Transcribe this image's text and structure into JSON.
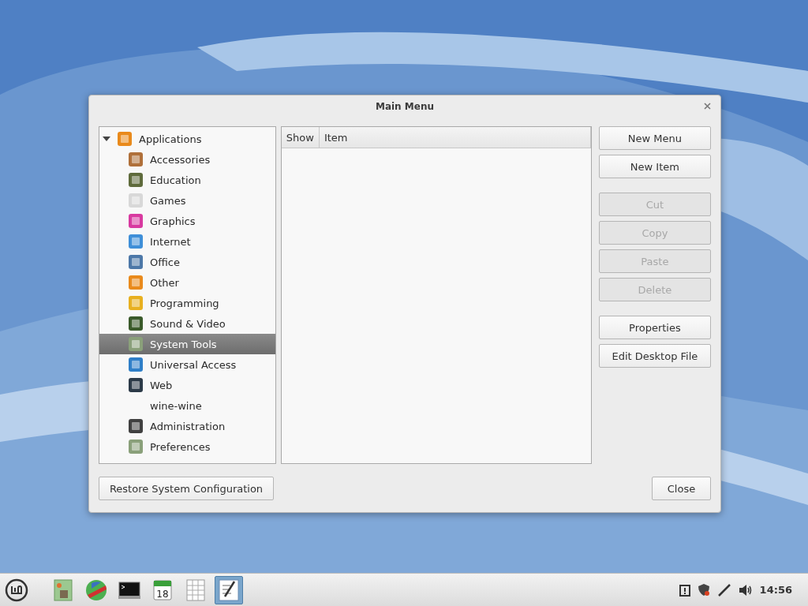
{
  "window": {
    "title": "Main Menu"
  },
  "tree": {
    "label": "Applications",
    "kind": "folder",
    "expanded": true,
    "children": [
      {
        "label": "Accessories",
        "kind": "accessories",
        "selected": false
      },
      {
        "label": "Education",
        "kind": "education",
        "selected": false
      },
      {
        "label": "Games",
        "kind": "games",
        "selected": false
      },
      {
        "label": "Graphics",
        "kind": "graphics",
        "selected": false
      },
      {
        "label": "Internet",
        "kind": "internet",
        "selected": false
      },
      {
        "label": "Office",
        "kind": "office",
        "selected": false
      },
      {
        "label": "Other",
        "kind": "folder",
        "selected": false
      },
      {
        "label": "Programming",
        "kind": "programming",
        "selected": false
      },
      {
        "label": "Sound & Video",
        "kind": "media",
        "selected": false
      },
      {
        "label": "System Tools",
        "kind": "tools",
        "selected": true
      },
      {
        "label": "Universal Access",
        "kind": "access",
        "selected": false
      },
      {
        "label": "Web",
        "kind": "web",
        "selected": false
      },
      {
        "label": "wine-wine",
        "kind": "none",
        "selected": false
      },
      {
        "label": "Administration",
        "kind": "admin",
        "selected": false
      },
      {
        "label": "Preferences",
        "kind": "tools",
        "selected": false
      }
    ]
  },
  "table": {
    "columns": [
      "Show",
      "Item"
    ]
  },
  "button_groups": [
    [
      {
        "label": "New Menu",
        "disabled": false
      },
      {
        "label": "New Item",
        "disabled": false
      }
    ],
    [
      {
        "label": "Cut",
        "disabled": true
      },
      {
        "label": "Copy",
        "disabled": true
      },
      {
        "label": "Paste",
        "disabled": true
      },
      {
        "label": "Delete",
        "disabled": true
      }
    ],
    [
      {
        "label": "Properties",
        "disabled": false
      },
      {
        "label": "Edit Desktop File",
        "disabled": false
      }
    ]
  ],
  "footer": {
    "restore": "Restore System Configuration",
    "close": "Close"
  },
  "taskbar": {
    "launchers": [
      {
        "kind": "files",
        "selected": false
      },
      {
        "kind": "globe",
        "selected": false
      },
      {
        "kind": "terminal",
        "selected": false
      },
      {
        "kind": "calendar",
        "text": "18",
        "selected": false
      },
      {
        "kind": "sheet",
        "selected": false
      },
      {
        "kind": "editor",
        "selected": true
      }
    ],
    "clock": "14:56"
  }
}
